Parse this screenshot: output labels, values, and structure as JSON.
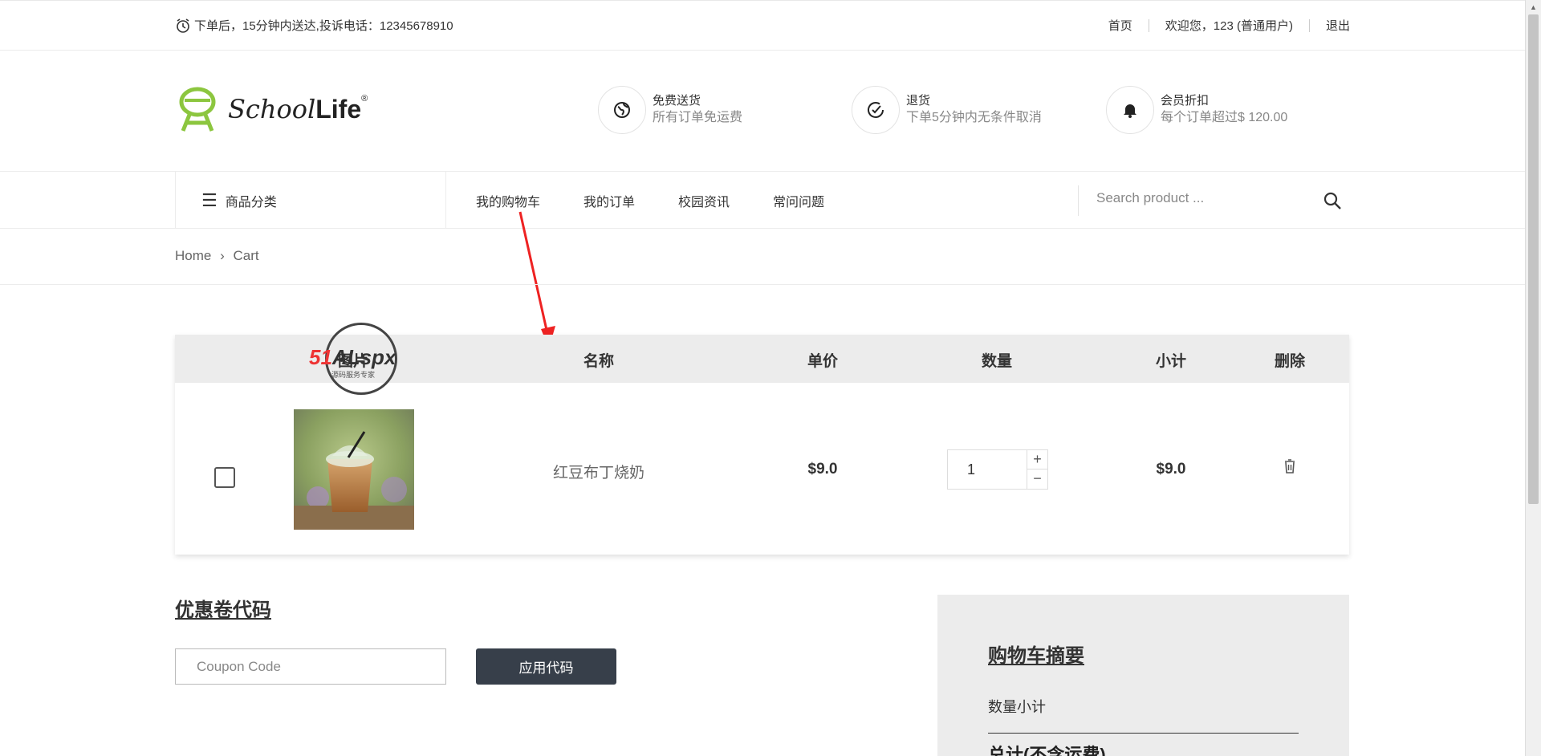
{
  "topbar": {
    "notice": "下单后，15分钟内送达,投诉电话：12345678910",
    "home": "首页",
    "welcome": "欢迎您，123 (普通用户)",
    "logout": "退出"
  },
  "logo": {
    "part1": "School",
    "part2": "Life",
    "reg": "®"
  },
  "features": [
    {
      "title": "免费送货",
      "desc": "所有订单免运费",
      "icon": "globe-icon"
    },
    {
      "title": "退货",
      "desc": "下单5分钟内无条件取消",
      "icon": "check-circle-icon"
    },
    {
      "title": "会员折扣",
      "desc": "每个订单超过$ 120.00",
      "icon": "bell-icon"
    }
  ],
  "nav": {
    "category": "商品分类",
    "items": [
      "我的购物车",
      "我的订单",
      "校园资讯",
      "常问问题"
    ],
    "search_placeholder": "Search product ..."
  },
  "breadcrumb": {
    "home": "Home",
    "sep": "›",
    "current": "Cart"
  },
  "cart": {
    "headers": [
      "图片",
      "名称",
      "单价",
      "数量",
      "小计",
      "删除"
    ],
    "rows": [
      {
        "name": "红豆布丁烧奶",
        "price": "$9.0",
        "qty": "1",
        "subtotal": "$9.0"
      }
    ]
  },
  "coupon": {
    "title": "优惠卷代码",
    "placeholder": "Coupon Code",
    "button": "应用代码"
  },
  "summary": {
    "title": "购物车摘要",
    "qty_subtotal": "数量小计",
    "total": "总计(不含运费)"
  },
  "watermark": {
    "text_a": "51",
    "text_b": "ALspx",
    "sub": "源码服务专家"
  },
  "colors": {
    "accent_dark": "#373f4a",
    "logo_green": "#8cc63f",
    "header_bg": "#ececec"
  }
}
